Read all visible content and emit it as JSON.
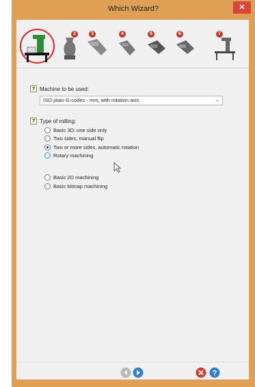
{
  "window": {
    "title": "Which Wizard?",
    "close_glyph": "✕"
  },
  "steps": [
    {
      "num": "",
      "icon": "milling-machine-icon"
    },
    {
      "num": "2",
      "icon": "vase-icon"
    },
    {
      "num": "3",
      "icon": "tool-icon"
    },
    {
      "num": "4",
      "icon": "tool-icon"
    },
    {
      "num": "5",
      "icon": "tool-icon"
    },
    {
      "num": "6",
      "icon": "tool-icon"
    },
    {
      "num": "7",
      "icon": "machine-icon"
    }
  ],
  "machine": {
    "help": "?",
    "label": "Machine to be used:",
    "selected": "ISO plain G-codes - mm, with rotation axis",
    "arrow": "⌄"
  },
  "milling": {
    "help": "?",
    "label": "Type of milling:",
    "options": [
      {
        "label": "Basic 3D: one side only",
        "checked": false
      },
      {
        "label": "Two sides, manual flip",
        "checked": false
      },
      {
        "label": "Two or more sides, automatic rotation",
        "checked": true
      },
      {
        "label": "Rotary machining",
        "checked": false,
        "hover": true
      },
      {
        "label": "Basic 2D machining",
        "checked": false
      },
      {
        "label": "Basic bitmap machining",
        "checked": false
      }
    ]
  },
  "colors": {
    "frame": "#dfa055",
    "close": "#d9453a",
    "step_badge": "#c0392b",
    "accent_ring": "#e02020"
  }
}
